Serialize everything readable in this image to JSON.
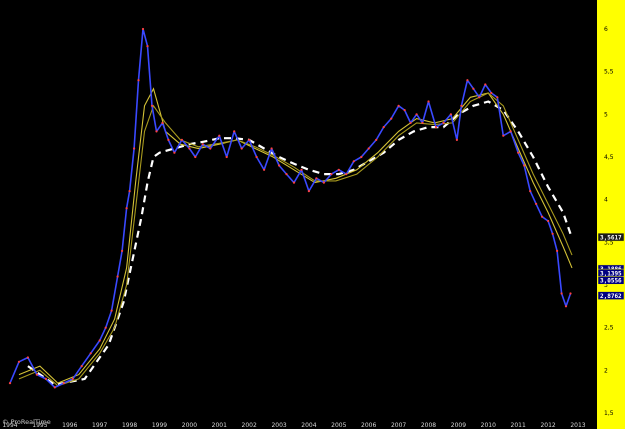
{
  "chart_data": {
    "type": "line",
    "title": "",
    "xlabel": "",
    "ylabel": "",
    "x_range": [
      1994.0,
      2013.0
    ],
    "ylim": [
      1.5,
      6.25
    ],
    "x_ticks": [
      1994,
      1995,
      1996,
      1997,
      1998,
      1999,
      2000,
      2001,
      2002,
      2003,
      2004,
      2005,
      2006,
      2007,
      2008,
      2009,
      2010,
      2011,
      2012,
      2013
    ],
    "y_ticks": [
      "1,5",
      "2",
      "2,5",
      "3",
      "3,5",
      "4",
      "4,5",
      "5",
      "5,5",
      "6"
    ],
    "y_tick_values": [
      1.5,
      2,
      2.5,
      3,
      3.5,
      4,
      4.5,
      5,
      5.5,
      6
    ],
    "grid": false,
    "legend": "none",
    "price_series": {
      "name": "",
      "color": "#3a49ff",
      "x": [
        1994.0,
        1994.3,
        1994.6,
        1994.9,
        1995.2,
        1995.5,
        1995.8,
        1996.1,
        1996.4,
        1996.7,
        1997.0,
        1997.2,
        1997.4,
        1997.6,
        1997.75,
        1997.9,
        1998.0,
        1998.15,
        1998.3,
        1998.45,
        1998.6,
        1998.75,
        1998.9,
        1999.1,
        1999.3,
        1999.5,
        1999.75,
        2000.0,
        2000.2,
        2000.45,
        2000.7,
        2001.0,
        2001.25,
        2001.5,
        2001.75,
        2002.0,
        2002.25,
        2002.5,
        2002.75,
        2003.0,
        2003.25,
        2003.5,
        2003.75,
        2004.0,
        2004.25,
        2004.5,
        2004.75,
        2005.0,
        2005.25,
        2005.5,
        2005.75,
        2006.0,
        2006.25,
        2006.5,
        2006.75,
        2007.0,
        2007.2,
        2007.4,
        2007.6,
        2007.8,
        2008.0,
        2008.25,
        2008.5,
        2008.75,
        2008.95,
        2009.1,
        2009.3,
        2009.5,
        2009.7,
        2009.9,
        2010.1,
        2010.3,
        2010.5,
        2010.75,
        2011.0,
        2011.2,
        2011.4,
        2011.6,
        2011.8,
        2012.0,
        2012.15,
        2012.3,
        2012.45,
        2012.6,
        2012.75
      ],
      "y": [
        1.85,
        2.1,
        2.15,
        1.95,
        1.9,
        1.8,
        1.85,
        1.9,
        2.05,
        2.2,
        2.35,
        2.5,
        2.7,
        3.1,
        3.4,
        3.9,
        4.1,
        4.6,
        5.4,
        6.0,
        5.8,
        5.1,
        4.8,
        4.9,
        4.7,
        4.55,
        4.7,
        4.6,
        4.5,
        4.65,
        4.6,
        4.75,
        4.5,
        4.8,
        4.6,
        4.7,
        4.5,
        4.35,
        4.6,
        4.4,
        4.3,
        4.2,
        4.35,
        4.1,
        4.25,
        4.2,
        4.3,
        4.35,
        4.3,
        4.45,
        4.5,
        4.6,
        4.7,
        4.85,
        4.95,
        5.1,
        5.05,
        4.9,
        5.0,
        4.9,
        5.15,
        4.85,
        4.9,
        5.0,
        4.7,
        5.1,
        5.4,
        5.3,
        5.2,
        5.35,
        5.25,
        5.2,
        4.75,
        4.8,
        4.55,
        4.4,
        4.1,
        3.95,
        3.8,
        3.75,
        3.6,
        3.4,
        2.9,
        2.75,
        2.9
      ]
    },
    "moving_averages": [
      {
        "name": "",
        "color": "#ffffff",
        "style": "dashed",
        "x": [
          1994.6,
          1995.5,
          1996.5,
          1997.3,
          1997.8,
          1998.1,
          1998.4,
          1998.6,
          1998.8,
          1999.0,
          1999.5,
          2000.0,
          2000.5,
          2001.0,
          2001.5,
          2002.0,
          2002.5,
          2003.0,
          2003.5,
          2004.0,
          2004.5,
          2005.0,
          2005.5,
          2006.0,
          2006.5,
          2007.0,
          2007.5,
          2008.0,
          2008.5,
          2009.0,
          2009.5,
          2010.0,
          2010.5,
          2011.0,
          2011.5,
          2012.0,
          2012.5,
          2012.8
        ],
        "y": [
          2.05,
          1.83,
          1.9,
          2.3,
          2.8,
          3.3,
          3.8,
          4.2,
          4.5,
          4.55,
          4.6,
          4.65,
          4.68,
          4.72,
          4.72,
          4.7,
          4.6,
          4.5,
          4.42,
          4.35,
          4.3,
          4.3,
          4.35,
          4.45,
          4.55,
          4.7,
          4.8,
          4.85,
          4.85,
          5.0,
          5.1,
          5.15,
          5.05,
          4.8,
          4.5,
          4.15,
          3.85,
          3.55
        ]
      },
      {
        "name": "",
        "color": "#d4c236",
        "style": "solid",
        "x": [
          1994.3,
          1995.0,
          1995.6,
          1996.3,
          1997.0,
          1997.5,
          1997.9,
          1998.2,
          1998.5,
          1998.8,
          1999.2,
          1999.7,
          2000.3,
          2001.0,
          2001.6,
          2002.2,
          2002.8,
          2003.5,
          2004.2,
          2004.9,
          2005.6,
          2006.3,
          2007.0,
          2007.6,
          2008.2,
          2008.8,
          2009.4,
          2010.0,
          2010.5,
          2011.0,
          2011.5,
          2012.0,
          2012.5,
          2012.8
        ],
        "y": [
          1.95,
          2.05,
          1.85,
          1.95,
          2.25,
          2.6,
          3.2,
          4.2,
          5.1,
          5.3,
          4.8,
          4.65,
          4.6,
          4.65,
          4.7,
          4.6,
          4.5,
          4.35,
          4.2,
          4.25,
          4.35,
          4.55,
          4.8,
          4.95,
          4.9,
          4.95,
          5.2,
          5.25,
          5.0,
          4.6,
          4.2,
          3.85,
          3.45,
          3.2
        ]
      },
      {
        "name": "",
        "color": "#a89a1e",
        "style": "solid",
        "x": [
          1994.3,
          1995.0,
          1995.6,
          1996.3,
          1997.0,
          1997.5,
          1997.9,
          1998.2,
          1998.5,
          1998.8,
          1999.2,
          1999.7,
          2000.3,
          2001.0,
          2001.6,
          2002.2,
          2002.8,
          2003.5,
          2004.2,
          2004.9,
          2005.6,
          2006.3,
          2007.0,
          2007.6,
          2008.2,
          2008.8,
          2009.4,
          2010.0,
          2010.5,
          2011.0,
          2011.5,
          2012.0,
          2012.5,
          2012.8
        ],
        "y": [
          1.9,
          2.0,
          1.82,
          1.9,
          2.2,
          2.5,
          3.0,
          3.9,
          4.8,
          5.1,
          4.9,
          4.7,
          4.62,
          4.66,
          4.7,
          4.62,
          4.52,
          4.38,
          4.22,
          4.22,
          4.3,
          4.5,
          4.75,
          4.9,
          4.88,
          4.9,
          5.15,
          5.25,
          5.1,
          4.7,
          4.3,
          3.95,
          3.6,
          3.35
        ]
      }
    ],
    "value_badges": [
      {
        "label": "3,5617",
        "value": 3.5617,
        "bg": "#1a1a1a",
        "fg": "#ffffff"
      },
      {
        "label": "3,1886",
        "value": 3.1886,
        "bg": "#000080",
        "fg": "#ffffff"
      },
      {
        "label": "3,1395",
        "value": 3.1395,
        "bg": "#000080",
        "fg": "#ffffff"
      },
      {
        "label": "3,0556",
        "value": 3.0556,
        "bg": "#000080",
        "fg": "#ffffff"
      },
      {
        "label": "2,8762",
        "value": 2.8762,
        "bg": "#000080",
        "fg": "#ffffff"
      }
    ],
    "axis_color": "#ffff00"
  },
  "footer": {
    "credit": "© ProRealTime"
  }
}
